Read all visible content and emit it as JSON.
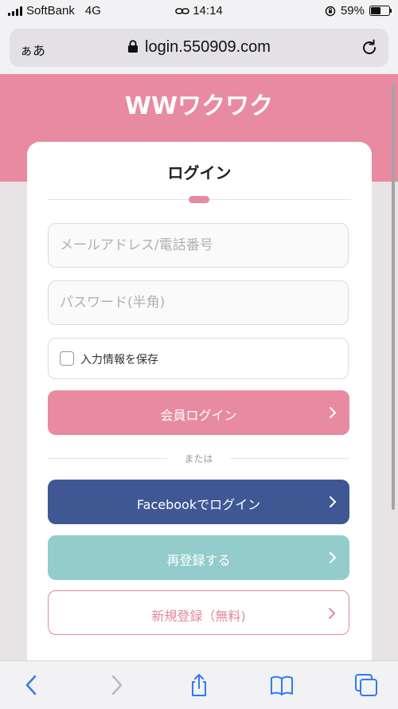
{
  "status_bar": {
    "carrier": "SoftBank",
    "network": "4G",
    "time": "14:14",
    "battery_percent": "59%",
    "battery_level": 0.59
  },
  "browser": {
    "text_size_label": "ぁあ",
    "url": "login.550909.com"
  },
  "brand": {
    "logo_text": "WWワクワク",
    "primary_color": "#e88aa0",
    "facebook_color": "#3f5894",
    "reregister_color": "#93cccb"
  },
  "login": {
    "title": "ログイン",
    "email_placeholder": "メールアドレス/電話番号",
    "password_placeholder": "パスワード(半角)",
    "remember_label": "入力情報を保存",
    "member_login_label": "会員ログイン",
    "or_label": "または",
    "facebook_login_label": "Facebookでログイン",
    "reregister_label": "再登録する",
    "signup_label": "新規登録（無料)"
  },
  "toolbar": {
    "icons": [
      "back-icon",
      "forward-icon",
      "share-icon",
      "bookmarks-icon",
      "tabs-icon"
    ]
  }
}
